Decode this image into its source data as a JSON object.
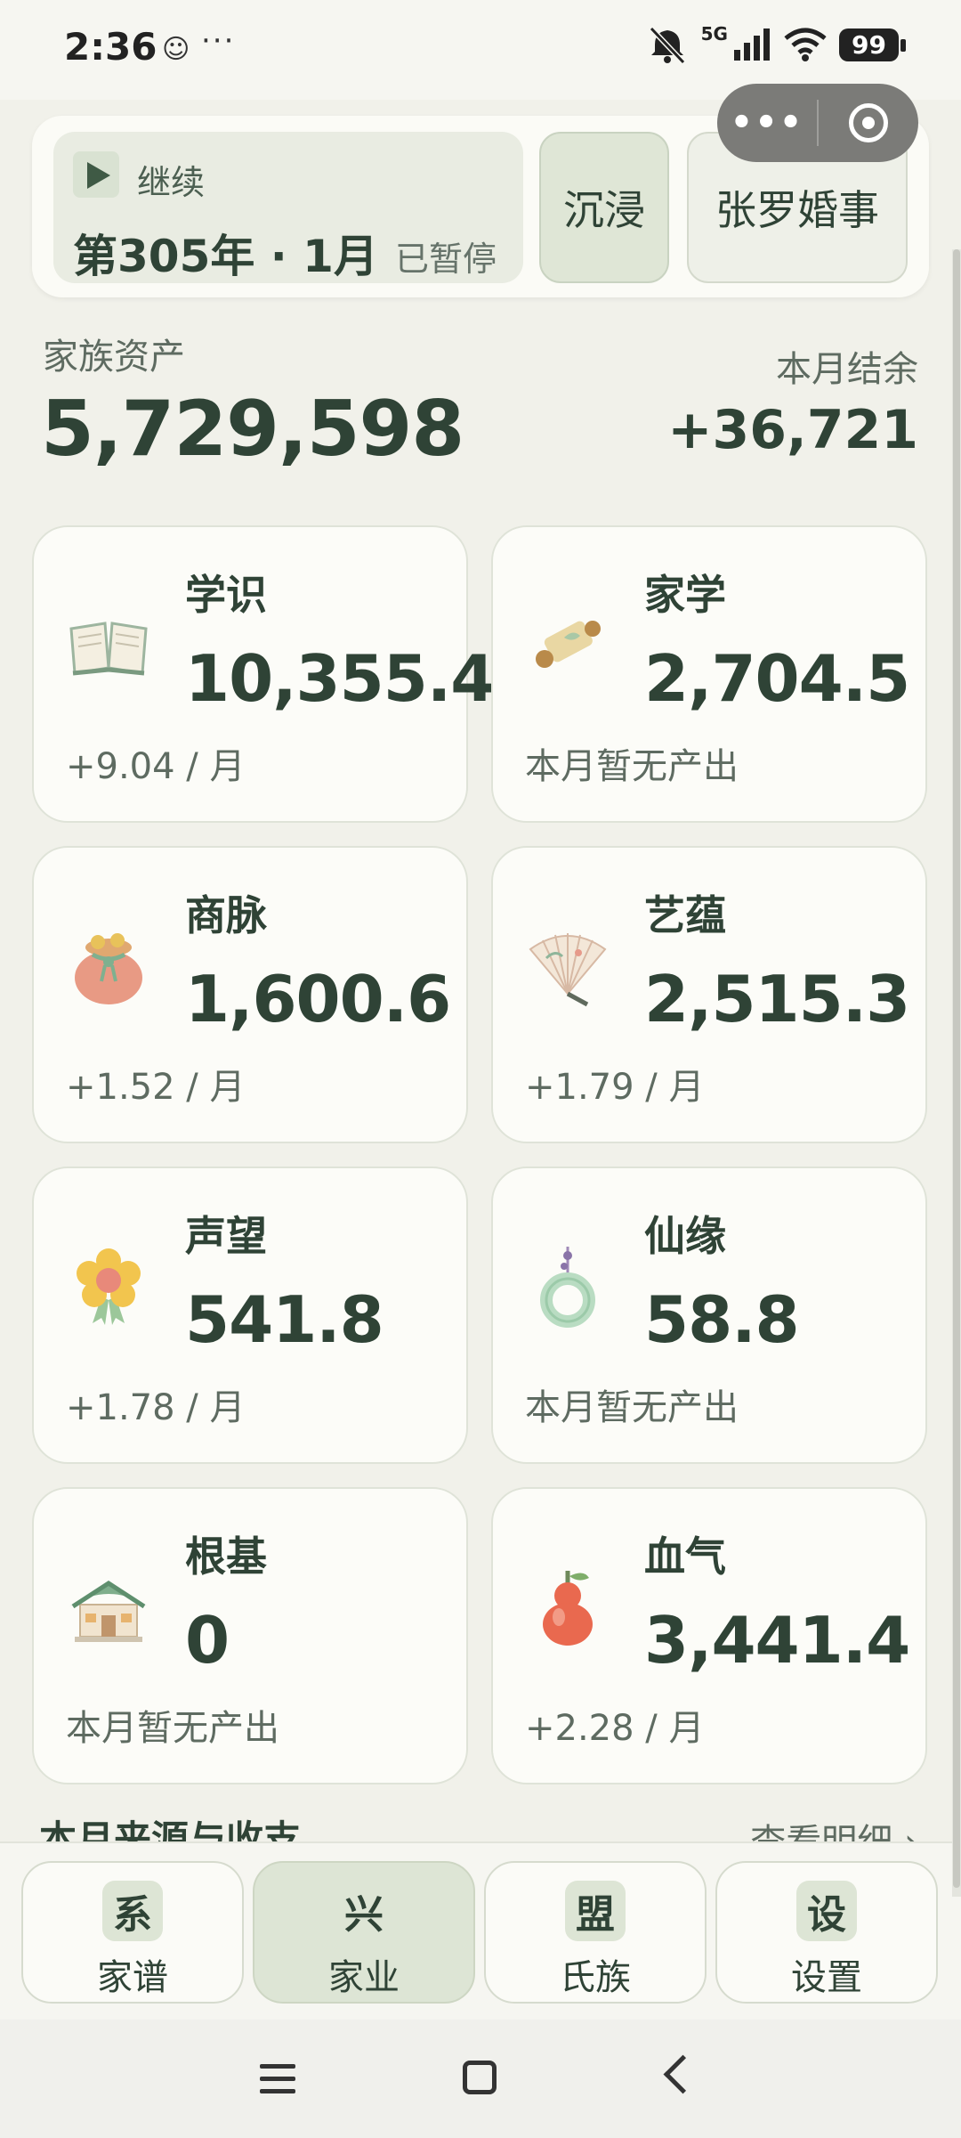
{
  "status_bar": {
    "time": "2:36",
    "dots": "···",
    "network": "5G",
    "battery": "99",
    "icons": [
      "ghost-icon",
      "mute-icon",
      "signal-icon",
      "wifi-icon",
      "battery-icon"
    ]
  },
  "capsule": {
    "more": "•••",
    "icons": [
      "more-dots-icon",
      "close-target-icon"
    ]
  },
  "controls": {
    "resume_label": "继续",
    "date": "第305年 · 1月",
    "status": "已暂停",
    "immerse": "沉浸",
    "wedding": "张罗婚事"
  },
  "summary": {
    "assets_label": "家族资产",
    "assets_value": "5,729,598",
    "balance_label": "本月结余",
    "balance_value": "+36,721"
  },
  "stats": [
    {
      "name": "学识",
      "value": "10,355.4",
      "rate": "+9.04 / 月",
      "icon": "book-icon"
    },
    {
      "name": "家学",
      "value": "2,704.5",
      "rate": "本月暂无产出",
      "icon": "scroll-icon"
    },
    {
      "name": "商脉",
      "value": "1,600.6",
      "rate": "+1.52 / 月",
      "icon": "money-pouch-icon"
    },
    {
      "name": "艺蕴",
      "value": "2,515.3",
      "rate": "+1.79 / 月",
      "icon": "folding-fan-icon"
    },
    {
      "name": "声望",
      "value": "541.8",
      "rate": "+1.78 / 月",
      "icon": "flower-medal-icon"
    },
    {
      "name": "仙缘",
      "value": "58.8",
      "rate": "本月暂无产出",
      "icon": "jade-pendant-icon"
    },
    {
      "name": "根基",
      "value": "0",
      "rate": "本月暂无产出",
      "icon": "house-icon"
    },
    {
      "name": "血气",
      "value": "3,441.4",
      "rate": "+2.28 / 月",
      "icon": "gourd-icon"
    }
  ],
  "section": {
    "title": "本月来源与收支",
    "link": "查看明细 ›"
  },
  "tabs": [
    {
      "glyph": "系",
      "label": "家谱"
    },
    {
      "glyph": "兴",
      "label": "家业"
    },
    {
      "glyph": "盟",
      "label": "氏族"
    },
    {
      "glyph": "设",
      "label": "设置"
    }
  ],
  "colors": {
    "background": "#f1f1ea",
    "text": "#2f4336",
    "accent": "#dde5d5",
    "card": "#fcfcf8"
  }
}
